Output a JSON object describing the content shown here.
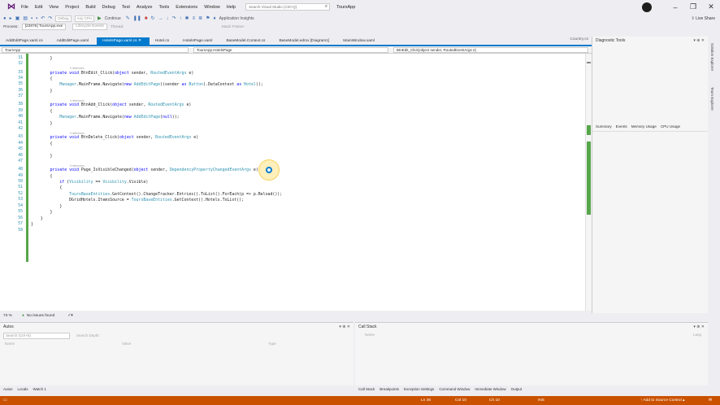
{
  "menubar": {
    "items": [
      "File",
      "Edit",
      "View",
      "Project",
      "Build",
      "Debug",
      "Test",
      "Analyze",
      "Tools",
      "Extensions",
      "Window",
      "Help"
    ],
    "search_placeholder": "Search Visual Studio (Ctrl+Q)",
    "project_name": "ToursApp"
  },
  "toolbar": {
    "config": "Debug",
    "platform": "Any CPU",
    "continue_label": "Continue",
    "app_insights": "Application Insights",
    "live_share": "Live Share"
  },
  "procbar": {
    "process_label": "Process:",
    "process_value": "[23876] ToursApp.exe",
    "lifecycle": "Lifecycle Events",
    "thread_label": "Thread:",
    "stack_frame": "Stack Frame:"
  },
  "tabs": [
    {
      "label": "AddEditPage.xaml.cs"
    },
    {
      "label": "AddEditPage.xaml"
    },
    {
      "label": "HotelsPage.xaml.cs",
      "active": true
    },
    {
      "label": "Hotel.cs"
    },
    {
      "label": "HotelsPage.xaml"
    },
    {
      "label": "BaseModel.Context.cs"
    },
    {
      "label": "BaseModel.edmx [Diagram1]"
    },
    {
      "label": "MainWindow.xaml"
    }
  ],
  "tab_right": "Country.cs",
  "navbar": {
    "project": "ToursApp",
    "class": "ToursApp.HotelsPage",
    "member": "BtnEdit_Click(object sender, RoutedEventArgs e)"
  },
  "code": {
    "ref_label": "0 references",
    "lines": [
      {
        "n": "31",
        "text": "        }"
      },
      {
        "n": "32",
        "text": ""
      },
      {
        "n": "33",
        "text": "        private void BtnEdit_Click(object sender, RoutedEventArgs e)"
      },
      {
        "n": "34",
        "text": "        {"
      },
      {
        "n": "35",
        "text": "            Manager.MainFrame.Navigate(new AddEditPage((sender as Button).DataContext as Hotel));"
      },
      {
        "n": "36",
        "text": "        }"
      },
      {
        "n": "37",
        "text": ""
      },
      {
        "n": "38",
        "text": "        private void BtnAdd_Click(object sender, RoutedEventArgs e)"
      },
      {
        "n": "39",
        "text": "        {"
      },
      {
        "n": "40",
        "text": "            Manager.MainFrame.Navigate(new AddEditPage(null));"
      },
      {
        "n": "41",
        "text": "        }"
      },
      {
        "n": "42",
        "text": ""
      },
      {
        "n": "43",
        "text": "        private void BtnDelete_Click(object sender, RoutedEventArgs e)"
      },
      {
        "n": "44",
        "text": "        {"
      },
      {
        "n": "45",
        "text": ""
      },
      {
        "n": "46",
        "text": "        }"
      },
      {
        "n": "47",
        "text": ""
      },
      {
        "n": "48",
        "text": "        private void Page_IsVisibleChanged(object sender, DependencyPropertyChangedEventArgs e)"
      },
      {
        "n": "49",
        "text": "        {"
      },
      {
        "n": "50",
        "text": "            if (Visibility == Visibility.Visible)"
      },
      {
        "n": "51",
        "text": "            {"
      },
      {
        "n": "52",
        "text": "                ToursBaseEntities.GetContext().ChangeTracker.Entries().ToList().ForEach(p => p.Reload());"
      },
      {
        "n": "53",
        "text": "                DGridHotels.ItemsSource = ToursBaseEntities.GetContext().Hotels.ToList();"
      },
      {
        "n": "54",
        "text": "            }"
      },
      {
        "n": "55",
        "text": "        }"
      },
      {
        "n": "56",
        "text": "    }"
      },
      {
        "n": "57",
        "text": "}"
      },
      {
        "n": "58",
        "text": ""
      }
    ]
  },
  "editor_status": {
    "zoom": "73 %",
    "issues": "No issues found"
  },
  "diagnostic": {
    "title": "Diagnostic Tools",
    "tabs": [
      "Summary",
      "Events",
      "Memory Usage",
      "CPU Usage"
    ]
  },
  "side_strip": [
    "Solution Explorer",
    "Team Explorer"
  ],
  "autos": {
    "title": "Autos",
    "search_placeholder": "Search (Ctrl+E)",
    "search_depth": "Search Depth:",
    "columns": [
      "Name",
      "Value",
      "Type"
    ],
    "tabs": [
      "Autos",
      "Locals",
      "Watch 1"
    ]
  },
  "callstack": {
    "title": "Call Stack",
    "columns": [
      "Name",
      "Lang"
    ],
    "tabs": [
      "Call Stack",
      "Breakpoints",
      "Exception Settings",
      "Command Window",
      "Immediate Window",
      "Output"
    ]
  },
  "statusbar": {
    "ln": "Ln 36",
    "col": "Col 10",
    "ch": "Ch 10",
    "ins": "INS",
    "source_control": "Add to Source Control"
  }
}
